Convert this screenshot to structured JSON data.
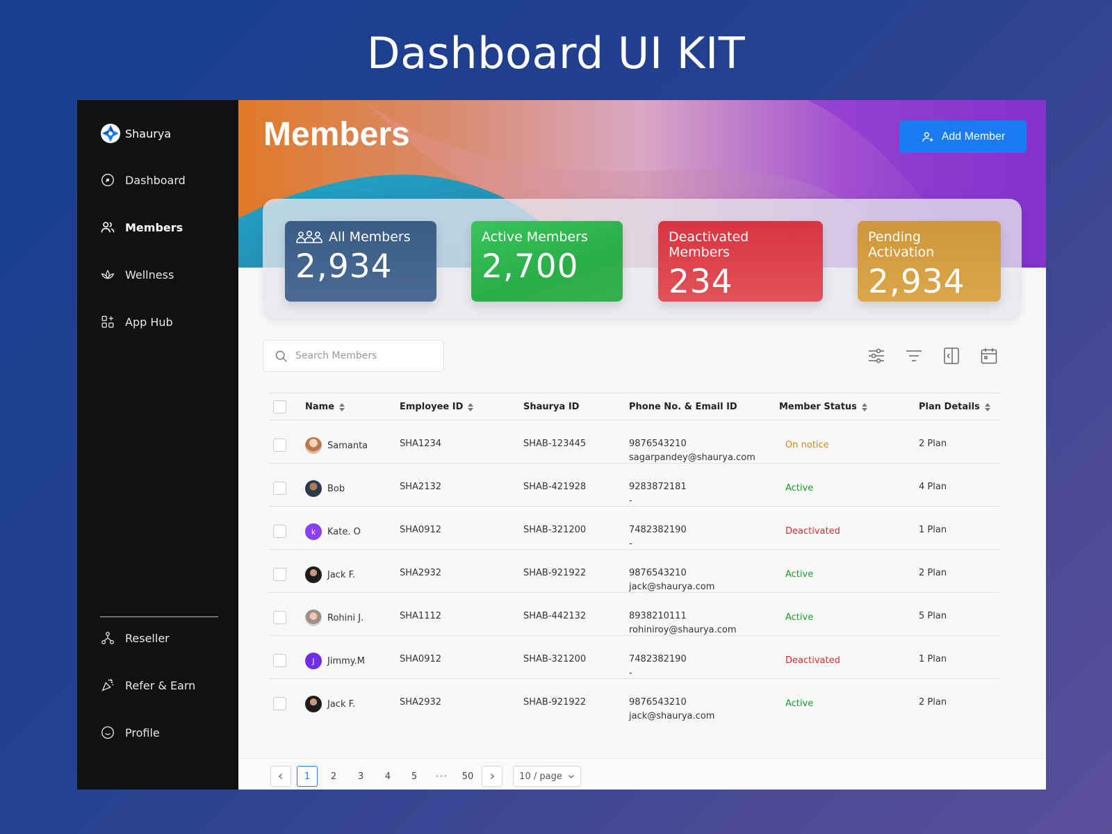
{
  "kit_title": "Dashboard UI KIT",
  "brand": {
    "name": "Shaurya"
  },
  "nav": {
    "dashboard": "Dashboard",
    "members": "Members",
    "wellness": "Wellness",
    "app_hub": "App Hub",
    "reseller": "Reseller",
    "refer_earn": "Refer & Earn",
    "profile": "Profile"
  },
  "header": {
    "title": "Members",
    "add_button": "Add Member"
  },
  "stats": {
    "all": {
      "label": "All Members",
      "value": "2,934"
    },
    "active": {
      "label": "Active Members",
      "value": "2,700"
    },
    "deactivated": {
      "label": "Deactivated Members",
      "value": "234"
    },
    "pending": {
      "label": "Pending Activation",
      "value": "2,934"
    }
  },
  "search": {
    "placeholder": "Search Members"
  },
  "table": {
    "columns": {
      "name": "Name",
      "employee_id": "Employee ID",
      "shaurya_id": "Shaurya ID",
      "contact": "Phone No. & Email ID",
      "status": "Member Status",
      "plan": "Plan Details"
    },
    "rows": [
      {
        "name": "Samanta",
        "employee_id": "SHA1234",
        "shaurya_id": "SHAB-123445",
        "phone": "9876543210",
        "email": "sagarpandey@shaurya.com",
        "status": "On notice",
        "plan": "2 Plan"
      },
      {
        "name": "Bob",
        "employee_id": "SHA2132",
        "shaurya_id": "SHAB-421928",
        "phone": "9283872181",
        "email": "-",
        "status": "Active",
        "plan": "4 Plan"
      },
      {
        "name": "Kate. O",
        "initial": "k",
        "employee_id": "SHA0912",
        "shaurya_id": "SHAB-321200",
        "phone": "7482382190",
        "email": "-",
        "status": "Deactivated",
        "plan": "1 Plan"
      },
      {
        "name": "Jack F.",
        "employee_id": "SHA2932",
        "shaurya_id": "SHAB-921922",
        "phone": "9876543210",
        "email": "jack@shaurya.com",
        "status": "Active",
        "plan": "2 Plan"
      },
      {
        "name": "Rohini J.",
        "employee_id": "SHA1112",
        "shaurya_id": "SHAB-442132",
        "phone": "8938210111",
        "email": "rohiniroy@shaurya.com",
        "status": "Active",
        "plan": "5 Plan"
      },
      {
        "name": "Jimmy.M",
        "initial": "J",
        "employee_id": "SHA0912",
        "shaurya_id": "SHAB-321200",
        "phone": "7482382190",
        "email": "-",
        "status": "Deactivated",
        "plan": "1 Plan"
      },
      {
        "name": "Jack F.",
        "employee_id": "SHA2932",
        "shaurya_id": "SHAB-921922",
        "phone": "9876543210",
        "email": "jack@shaurya.com",
        "status": "Active",
        "plan": "2 Plan"
      }
    ]
  },
  "pagination": {
    "pages": [
      "1",
      "2",
      "3",
      "4",
      "5"
    ],
    "ellipsis": "•••",
    "last": "50",
    "current": "1",
    "page_size": "10 / page"
  },
  "colors": {
    "accent": "#1a7cf3",
    "status_notice": "#d28a12",
    "status_active": "#1b9a2a",
    "status_deactivated": "#dc2a2a"
  }
}
